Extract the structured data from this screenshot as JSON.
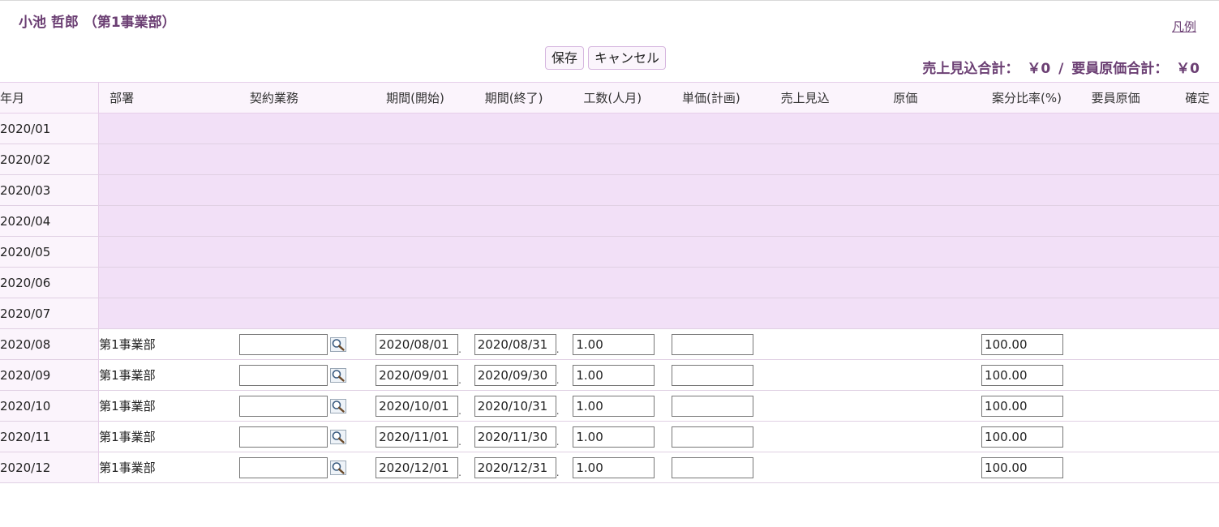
{
  "header": {
    "title": "小池 哲郎 （第1事業部）",
    "legend_link": "凡例",
    "save_label": "保存",
    "cancel_label": "キャンセル",
    "sales_total_label": "売上見込合計：",
    "sales_total_value": "￥0",
    "separator": "/",
    "cost_total_label": "要員原価合計：",
    "cost_total_value": "￥0"
  },
  "columns": [
    "年月",
    "部署",
    "契約業務",
    "期間(開始)",
    "期間(終了)",
    "工数(人月)",
    "単価(計画)",
    "売上見込",
    "原価",
    "案分比率(%)",
    "要員原価",
    "確定"
  ],
  "disabled_rows": [
    {
      "ym": "2020/01"
    },
    {
      "ym": "2020/02"
    },
    {
      "ym": "2020/03"
    },
    {
      "ym": "2020/04"
    },
    {
      "ym": "2020/05"
    },
    {
      "ym": "2020/06"
    },
    {
      "ym": "2020/07"
    }
  ],
  "rows": [
    {
      "ym": "2020/08",
      "dept": "第1事業部",
      "contract": "",
      "start": "2020/08/01",
      "end": "2020/08/31",
      "effort": "1.00",
      "unit_price": "",
      "sales": "",
      "cost": "",
      "ratio": "100.00",
      "staff_cost": "",
      "confirmed": ""
    },
    {
      "ym": "2020/09",
      "dept": "第1事業部",
      "contract": "",
      "start": "2020/09/01",
      "end": "2020/09/30",
      "effort": "1.00",
      "unit_price": "",
      "sales": "",
      "cost": "",
      "ratio": "100.00",
      "staff_cost": "",
      "confirmed": ""
    },
    {
      "ym": "2020/10",
      "dept": "第1事業部",
      "contract": "",
      "start": "2020/10/01",
      "end": "2020/10/31",
      "effort": "1.00",
      "unit_price": "",
      "sales": "",
      "cost": "",
      "ratio": "100.00",
      "staff_cost": "",
      "confirmed": ""
    },
    {
      "ym": "2020/11",
      "dept": "第1事業部",
      "contract": "",
      "start": "2020/11/01",
      "end": "2020/11/30",
      "effort": "1.00",
      "unit_price": "",
      "sales": "",
      "cost": "",
      "ratio": "100.00",
      "staff_cost": "",
      "confirmed": ""
    },
    {
      "ym": "2020/12",
      "dept": "第1事業部",
      "contract": "",
      "start": "2020/12/01",
      "end": "2020/12/31",
      "effort": "1.00",
      "unit_price": "",
      "sales": "",
      "cost": "",
      "ratio": "100.00",
      "staff_cost": "",
      "confirmed": ""
    }
  ],
  "icons": {
    "contract_search": "magnifier-icon"
  },
  "colors": {
    "accent": "#6b3f73",
    "disabled_bg": "#f2e0f7",
    "header_bg": "#fbf4fc"
  }
}
